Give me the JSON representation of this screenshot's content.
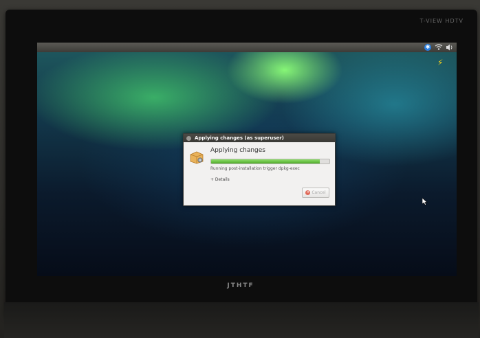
{
  "tv": {
    "brand": "T-VIEW HDTV",
    "logo": "JTHTF"
  },
  "panel": {
    "tray_icons": [
      "bluetooth-icon",
      "wifi-icon",
      "volume-icon"
    ],
    "bluetooth_glyph": "✱",
    "power_glyph": "⚡"
  },
  "dialog": {
    "title": "Applying changes (as superuser)",
    "heading": "Applying changes",
    "progress": 0.92,
    "status": "Running post-installation trigger dpkg-exec",
    "details": "+ Details",
    "cancel": "Cancel",
    "cancel_glyph": "×"
  },
  "colors": {
    "accent": "#4faa2a",
    "cancel_icon": "#e06a5a",
    "bluetooth": "#2a7fe0"
  }
}
